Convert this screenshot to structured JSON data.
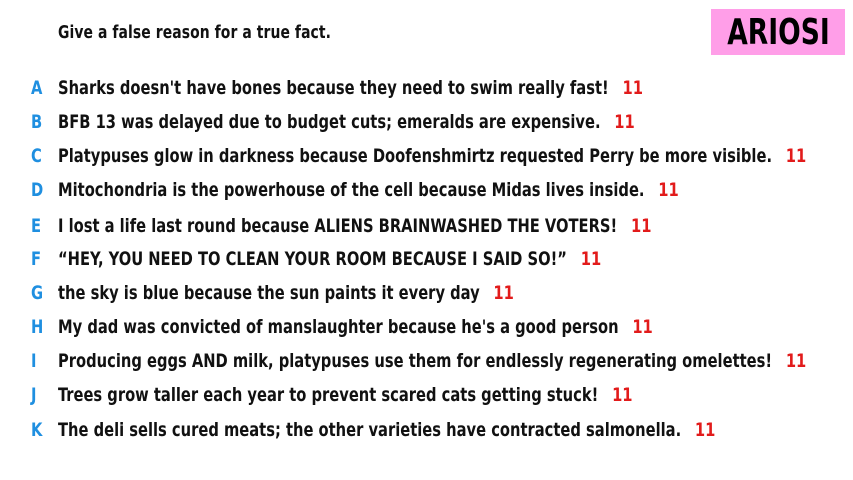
{
  "prompt": "Give a false reason for a true fact.",
  "name_badge": "ARIOSI",
  "colors": {
    "letter": "#1f8fe0",
    "count": "#e21b1b",
    "badge_bg": "#ff9ee8",
    "text": "#111111"
  },
  "responses": [
    {
      "letter": "A",
      "text": "Sharks doesn't have bones because they need to swim really fast!",
      "count": "11"
    },
    {
      "letter": "B",
      "text": "BFB 13 was delayed due to budget cuts; emeralds are expensive.",
      "count": "11"
    },
    {
      "letter": "C",
      "text": "Platypuses glow in darkness because Doofenshmirtz requested Perry be more visible.",
      "count": "11"
    },
    {
      "letter": "D",
      "text": "Mitochondria is the powerhouse of the cell because Midas lives inside.",
      "count": "11"
    },
    {
      "letter": "E",
      "text": "I lost a life last round because ALIENS BRAINWASHED THE VOTERS!",
      "count": "11"
    },
    {
      "letter": "F",
      "text": "“HEY, YOU NEED TO CLEAN YOUR ROOM BECAUSE I SAID SO!”",
      "count": "11"
    },
    {
      "letter": "G",
      "text": "the sky is blue because the sun paints it every day",
      "count": "11"
    },
    {
      "letter": "H",
      "text": "My dad was convicted of manslaughter because he's a good person",
      "count": "11"
    },
    {
      "letter": "I",
      "text": "Producing eggs AND milk, platypuses use them for endlessly regenerating omelettes!",
      "count": "11"
    },
    {
      "letter": "J",
      "text": "Trees grow taller each year to prevent scared cats getting stuck!",
      "count": "11"
    },
    {
      "letter": "K",
      "text": "The deli sells cured meats; the other varieties have contracted salmonella.",
      "count": "11"
    }
  ]
}
